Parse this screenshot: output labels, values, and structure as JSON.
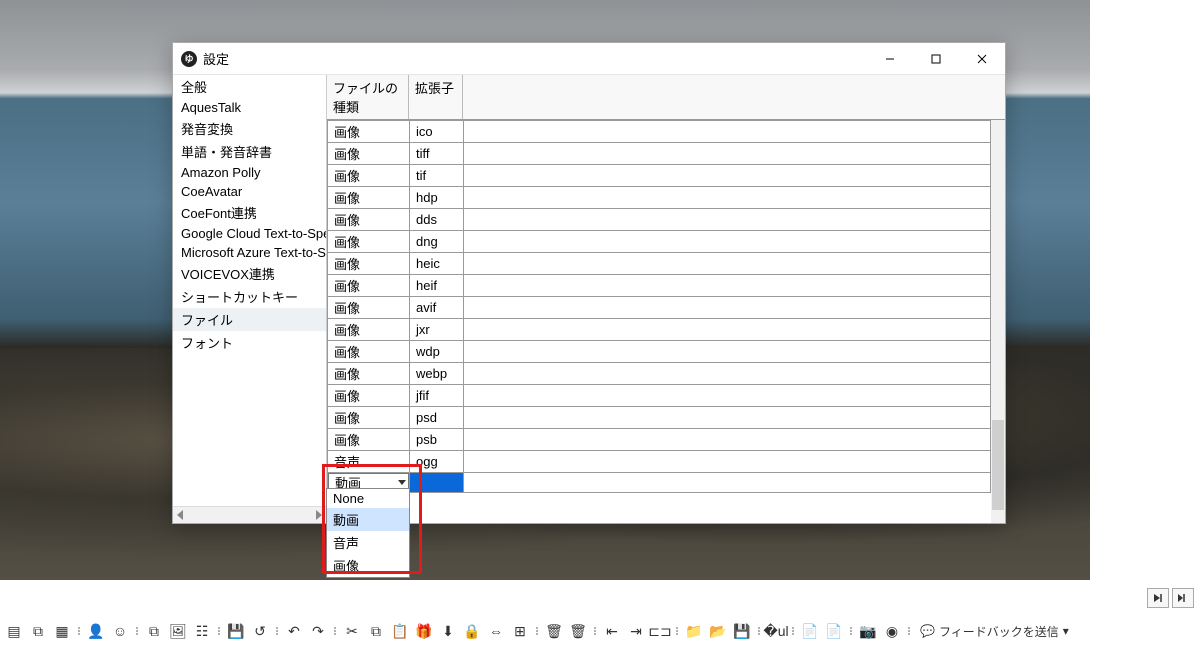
{
  "backdrop_alt": "coastal rocks and ocean",
  "window": {
    "icon_text": "ゆ",
    "title": "設定",
    "buttons": {
      "min": "minimize",
      "max": "maximize",
      "close": "close"
    }
  },
  "sidebar": {
    "items": [
      "全般",
      "AquesTalk",
      "発音変換",
      "単語・発音辞書",
      "Amazon Polly",
      "CoeAvatar",
      "CoeFont連携",
      "Google Cloud Text-to-Spee",
      "Microsoft Azure Text-to-Sp",
      "VOICEVOX連携",
      "ショートカットキー",
      "ファイル",
      "フォント"
    ],
    "selected_index": 11
  },
  "table": {
    "columns": {
      "type": "ファイルの種類",
      "ext": "拡張子"
    },
    "rows": [
      {
        "type": "画像",
        "ext": "ico"
      },
      {
        "type": "画像",
        "ext": "tiff"
      },
      {
        "type": "画像",
        "ext": "tif"
      },
      {
        "type": "画像",
        "ext": "hdp"
      },
      {
        "type": "画像",
        "ext": "dds"
      },
      {
        "type": "画像",
        "ext": "dng"
      },
      {
        "type": "画像",
        "ext": "heic"
      },
      {
        "type": "画像",
        "ext": "heif"
      },
      {
        "type": "画像",
        "ext": "avif"
      },
      {
        "type": "画像",
        "ext": "jxr"
      },
      {
        "type": "画像",
        "ext": "wdp"
      },
      {
        "type": "画像",
        "ext": "webp"
      },
      {
        "type": "画像",
        "ext": "jfif"
      },
      {
        "type": "画像",
        "ext": "psd"
      },
      {
        "type": "画像",
        "ext": "psb"
      },
      {
        "type": "音声",
        "ext": "ogg"
      }
    ],
    "editing_row": {
      "display": "動画",
      "ext": "",
      "options": [
        "None",
        "動画",
        "音声",
        "画像"
      ],
      "highlight_index": 1
    }
  },
  "toolbar": {
    "play": "▶",
    "step": "▶|",
    "feedback_label": "フィードバックを送信"
  }
}
